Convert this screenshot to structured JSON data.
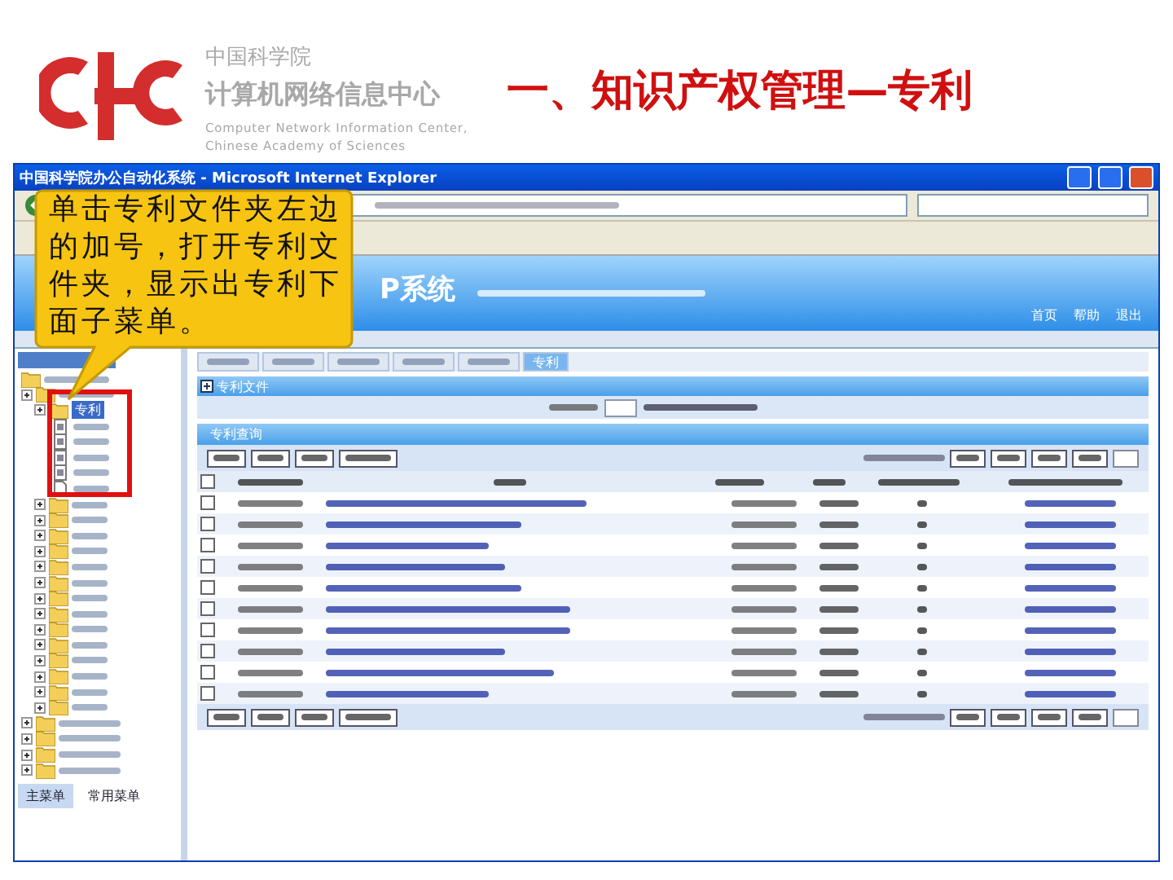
{
  "header": {
    "org_name": "中国科学院",
    "center_name": "计算机网络信息中心",
    "english_line_1": "Computer Network Information Center,",
    "english_line_2": "Chinese Academy of Sciences"
  },
  "slide_title": "一、知识产权管理—专利",
  "window": {
    "title": "中国科学院办公自动化系统 - Microsoft Internet Explorer"
  },
  "app": {
    "title": "P系统",
    "top_links": [
      "首页",
      "帮助",
      "退出"
    ]
  },
  "tabs": [
    {
      "selected": false
    },
    {
      "selected": false
    },
    {
      "selected": false
    },
    {
      "selected": false
    },
    {
      "selected": false
    },
    {
      "label": "专利",
      "selected": true
    }
  ],
  "tree": {
    "open_folder": {
      "label": "专利",
      "selected": true,
      "children": [
        {
          "kind": "form"
        },
        {
          "kind": "form"
        },
        {
          "kind": "form"
        },
        {
          "kind": "form"
        },
        {
          "kind": "page"
        }
      ]
    },
    "folders": [
      {
        "kind": "folder"
      },
      {
        "kind": "folder"
      },
      {
        "kind": "folder"
      },
      {
        "kind": "folder"
      },
      {
        "kind": "folder"
      },
      {
        "kind": "folder"
      },
      {
        "kind": "folder"
      },
      {
        "kind": "folder"
      },
      {
        "kind": "folder"
      },
      {
        "kind": "folder"
      },
      {
        "kind": "folder"
      },
      {
        "kind": "folder"
      },
      {
        "kind": "folder"
      },
      {
        "kind": "folder"
      }
    ],
    "root_folders": [
      {
        "kind": "folder"
      },
      {
        "kind": "folder"
      },
      {
        "kind": "folder"
      },
      {
        "kind": "folder"
      }
    ]
  },
  "sidebar_tabs": [
    {
      "label": "主菜单",
      "selected": true
    },
    {
      "label": "常用菜单",
      "selected": false
    }
  ],
  "panel": {
    "section": "专利文件",
    "title": "专利查询",
    "select_all_checked": false
  },
  "rows": [
    {
      "checked": false
    },
    {
      "checked": false
    },
    {
      "checked": false
    },
    {
      "checked": false
    },
    {
      "checked": false
    },
    {
      "checked": false
    },
    {
      "checked": false
    },
    {
      "checked": false
    },
    {
      "checked": false
    },
    {
      "checked": false
    }
  ],
  "callout": {
    "text": "单击专利文件夹左边的加号，打开专利文件夹，显示出专利下面子菜单。"
  }
}
